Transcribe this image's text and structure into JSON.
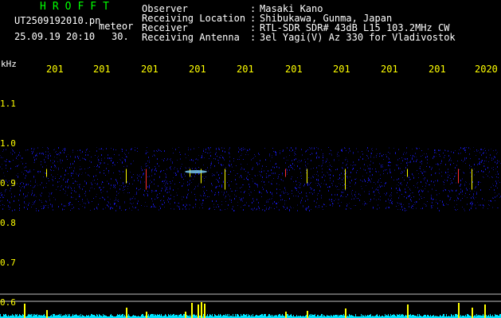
{
  "header": {
    "title": "HROFFT",
    "filename": "UT2509192010.pn",
    "overlay_label": "meteor",
    "datetime": "25.09.19 20:10",
    "count": "30.",
    "colon": ":"
  },
  "info": [
    {
      "label": "Observer",
      "value": "Masaki Kano"
    },
    {
      "label": "Receiving Location",
      "value": "Shibukawa, Gunma, Japan"
    },
    {
      "label": "Receiver",
      "value": "RTL-SDR SDR# 43dB L15 103.2MHz CW"
    },
    {
      "label": "Receiving Antenna",
      "value": "3el Yagi(V) Az 330 for Vladivostok"
    }
  ],
  "chart_data": {
    "type": "heatmap",
    "ylabel": "kHz",
    "x_ticks": [
      "201",
      "201",
      "201",
      "201",
      "201",
      "201",
      "201",
      "201",
      "201",
      "2020"
    ],
    "y_ticks": [
      "1.1",
      "1.0",
      "0.9",
      "0.8",
      "0.7",
      "0.6"
    ],
    "ylim": [
      0.58,
      1.17
    ],
    "signal_band": [
      0.83,
      0.99
    ],
    "meteor_echo_lines_at": [
      "201",
      "201",
      "201",
      "201",
      "201",
      "201",
      "201",
      "201",
      "201"
    ]
  },
  "colors": {
    "title": "#00ff00",
    "text": "#ffffff",
    "tick": "#ffff00",
    "ylabel": "#ffffff",
    "background": "#000000",
    "noise": "#1b1bff",
    "baseline": "#00e5ff",
    "echo_hot": "#ffff00",
    "echo_warm": "#ff3030"
  }
}
